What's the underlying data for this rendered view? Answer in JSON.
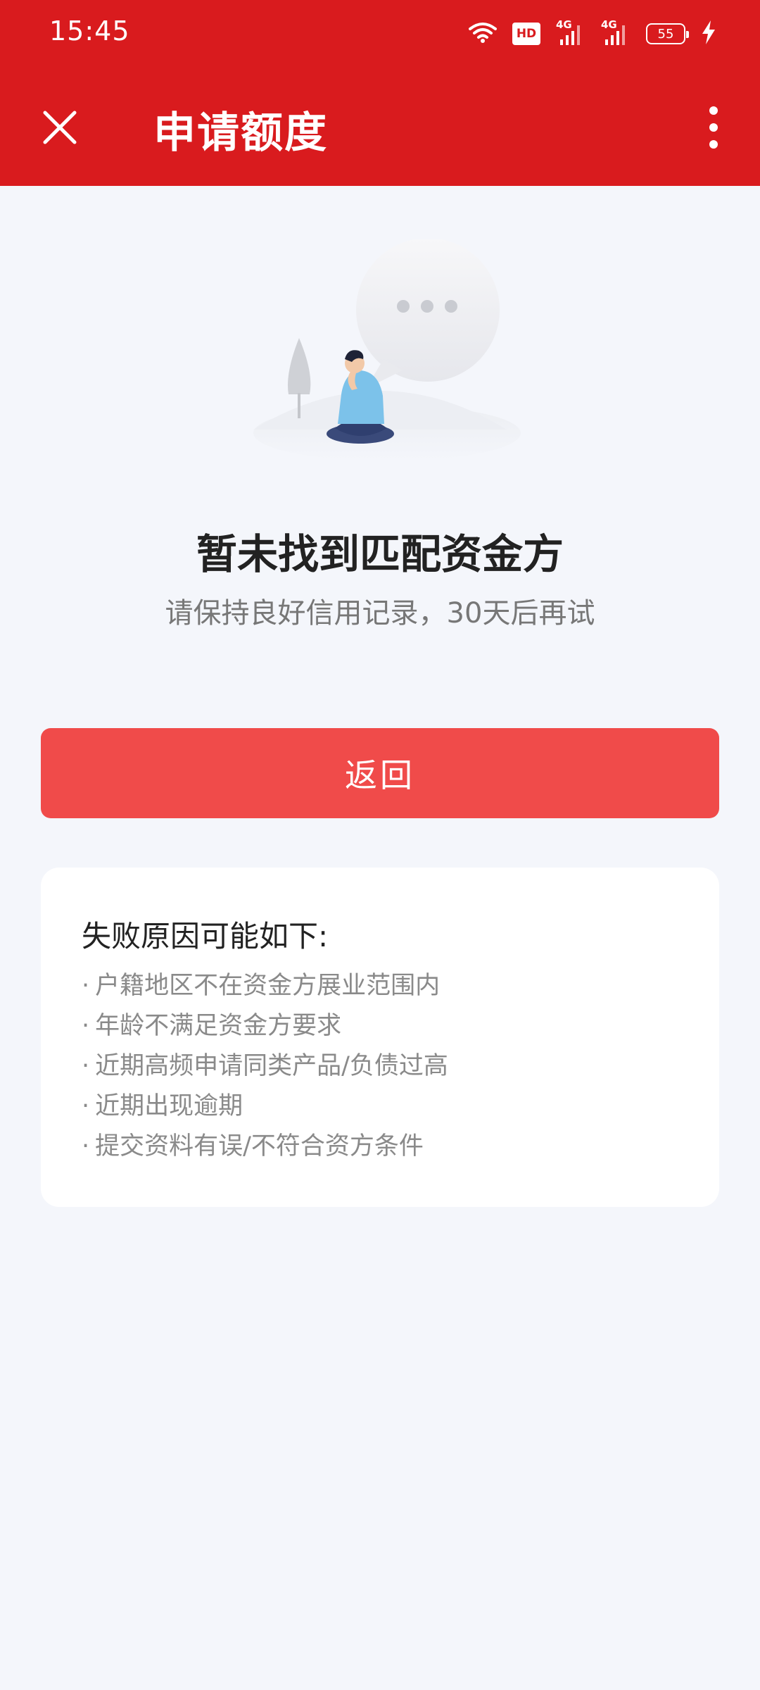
{
  "status_bar": {
    "time": "15:45",
    "hd_label": "HD",
    "network_labels": [
      "4G",
      "4G"
    ],
    "battery_level": "55"
  },
  "toolbar": {
    "title": "申请额度",
    "close_icon": "close-icon",
    "more_icon": "more-vertical-icon"
  },
  "result": {
    "illustration": "person-thinking-illustration",
    "title": "暂未找到匹配资金方",
    "subtitle": "请保持良好信用记录，30天后再试"
  },
  "back_button": {
    "label": "返回"
  },
  "reasons": {
    "heading": "失败原因可能如下:",
    "items": [
      "户籍地区不在资金方展业范围内",
      "年龄不满足资金方要求",
      "近期高频申请同类产品/负债过高",
      "近期出现逾期",
      "提交资料有误/不符合资方条件"
    ]
  },
  "colors": {
    "header_red": "#d91b1e",
    "button_red": "#f04b4a",
    "page_background": "#f4f6fb"
  }
}
